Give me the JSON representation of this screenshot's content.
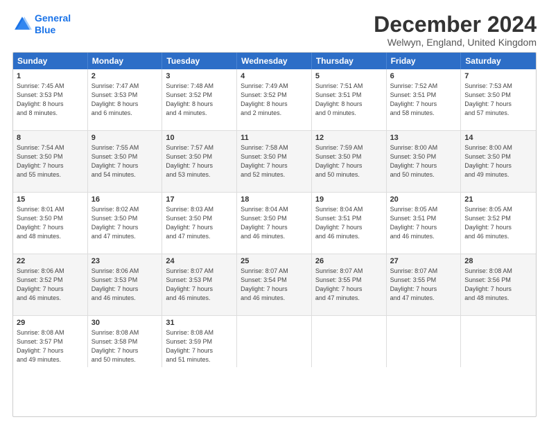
{
  "logo": {
    "line1": "General",
    "line2": "Blue"
  },
  "title": "December 2024",
  "location": "Welwyn, England, United Kingdom",
  "days_header": [
    "Sunday",
    "Monday",
    "Tuesday",
    "Wednesday",
    "Thursday",
    "Friday",
    "Saturday"
  ],
  "weeks": [
    [
      {
        "day": "1",
        "info": "Sunrise: 7:45 AM\nSunset: 3:53 PM\nDaylight: 8 hours\nand 8 minutes."
      },
      {
        "day": "2",
        "info": "Sunrise: 7:47 AM\nSunset: 3:53 PM\nDaylight: 8 hours\nand 6 minutes."
      },
      {
        "day": "3",
        "info": "Sunrise: 7:48 AM\nSunset: 3:52 PM\nDaylight: 8 hours\nand 4 minutes."
      },
      {
        "day": "4",
        "info": "Sunrise: 7:49 AM\nSunset: 3:52 PM\nDaylight: 8 hours\nand 2 minutes."
      },
      {
        "day": "5",
        "info": "Sunrise: 7:51 AM\nSunset: 3:51 PM\nDaylight: 8 hours\nand 0 minutes."
      },
      {
        "day": "6",
        "info": "Sunrise: 7:52 AM\nSunset: 3:51 PM\nDaylight: 7 hours\nand 58 minutes."
      },
      {
        "day": "7",
        "info": "Sunrise: 7:53 AM\nSunset: 3:50 PM\nDaylight: 7 hours\nand 57 minutes."
      }
    ],
    [
      {
        "day": "8",
        "info": "Sunrise: 7:54 AM\nSunset: 3:50 PM\nDaylight: 7 hours\nand 55 minutes."
      },
      {
        "day": "9",
        "info": "Sunrise: 7:55 AM\nSunset: 3:50 PM\nDaylight: 7 hours\nand 54 minutes."
      },
      {
        "day": "10",
        "info": "Sunrise: 7:57 AM\nSunset: 3:50 PM\nDaylight: 7 hours\nand 53 minutes."
      },
      {
        "day": "11",
        "info": "Sunrise: 7:58 AM\nSunset: 3:50 PM\nDaylight: 7 hours\nand 52 minutes."
      },
      {
        "day": "12",
        "info": "Sunrise: 7:59 AM\nSunset: 3:50 PM\nDaylight: 7 hours\nand 50 minutes."
      },
      {
        "day": "13",
        "info": "Sunrise: 8:00 AM\nSunset: 3:50 PM\nDaylight: 7 hours\nand 50 minutes."
      },
      {
        "day": "14",
        "info": "Sunrise: 8:00 AM\nSunset: 3:50 PM\nDaylight: 7 hours\nand 49 minutes."
      }
    ],
    [
      {
        "day": "15",
        "info": "Sunrise: 8:01 AM\nSunset: 3:50 PM\nDaylight: 7 hours\nand 48 minutes."
      },
      {
        "day": "16",
        "info": "Sunrise: 8:02 AM\nSunset: 3:50 PM\nDaylight: 7 hours\nand 47 minutes."
      },
      {
        "day": "17",
        "info": "Sunrise: 8:03 AM\nSunset: 3:50 PM\nDaylight: 7 hours\nand 47 minutes."
      },
      {
        "day": "18",
        "info": "Sunrise: 8:04 AM\nSunset: 3:50 PM\nDaylight: 7 hours\nand 46 minutes."
      },
      {
        "day": "19",
        "info": "Sunrise: 8:04 AM\nSunset: 3:51 PM\nDaylight: 7 hours\nand 46 minutes."
      },
      {
        "day": "20",
        "info": "Sunrise: 8:05 AM\nSunset: 3:51 PM\nDaylight: 7 hours\nand 46 minutes."
      },
      {
        "day": "21",
        "info": "Sunrise: 8:05 AM\nSunset: 3:52 PM\nDaylight: 7 hours\nand 46 minutes."
      }
    ],
    [
      {
        "day": "22",
        "info": "Sunrise: 8:06 AM\nSunset: 3:52 PM\nDaylight: 7 hours\nand 46 minutes."
      },
      {
        "day": "23",
        "info": "Sunrise: 8:06 AM\nSunset: 3:53 PM\nDaylight: 7 hours\nand 46 minutes."
      },
      {
        "day": "24",
        "info": "Sunrise: 8:07 AM\nSunset: 3:53 PM\nDaylight: 7 hours\nand 46 minutes."
      },
      {
        "day": "25",
        "info": "Sunrise: 8:07 AM\nSunset: 3:54 PM\nDaylight: 7 hours\nand 46 minutes."
      },
      {
        "day": "26",
        "info": "Sunrise: 8:07 AM\nSunset: 3:55 PM\nDaylight: 7 hours\nand 47 minutes."
      },
      {
        "day": "27",
        "info": "Sunrise: 8:07 AM\nSunset: 3:55 PM\nDaylight: 7 hours\nand 47 minutes."
      },
      {
        "day": "28",
        "info": "Sunrise: 8:08 AM\nSunset: 3:56 PM\nDaylight: 7 hours\nand 48 minutes."
      }
    ],
    [
      {
        "day": "29",
        "info": "Sunrise: 8:08 AM\nSunset: 3:57 PM\nDaylight: 7 hours\nand 49 minutes."
      },
      {
        "day": "30",
        "info": "Sunrise: 8:08 AM\nSunset: 3:58 PM\nDaylight: 7 hours\nand 50 minutes."
      },
      {
        "day": "31",
        "info": "Sunrise: 8:08 AM\nSunset: 3:59 PM\nDaylight: 7 hours\nand 51 minutes."
      },
      {
        "day": "",
        "info": ""
      },
      {
        "day": "",
        "info": ""
      },
      {
        "day": "",
        "info": ""
      },
      {
        "day": "",
        "info": ""
      }
    ]
  ]
}
